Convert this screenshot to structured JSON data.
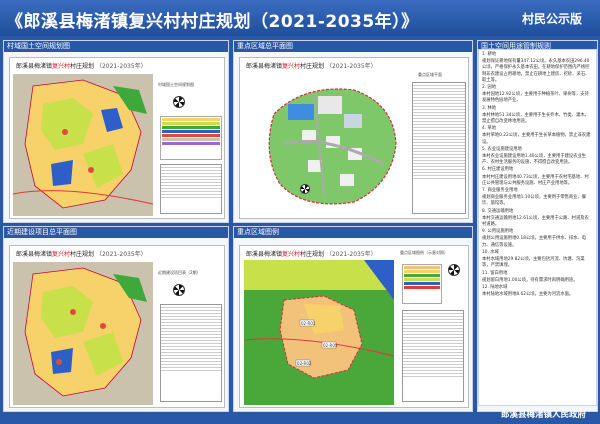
{
  "banner": {
    "title": "《郎溪县梅渚镇复兴村村庄规划（2021-2035年）》",
    "tag": "村民公示版"
  },
  "panels": {
    "village_land": "村域国土空间规划图",
    "recent_projects": "近期建设项目总平面图",
    "key_plan": "重点区域总平面图",
    "key_map": "重点区域图例",
    "land_control": "国土空间用途管制规则"
  },
  "sheets": {
    "sheet_title_prefix": "郎溪县梅渚镇",
    "sheet_title_highlight": "复兴村",
    "sheet_title_suffix": "村庄规划",
    "sheet_year": "（2021-2035年）",
    "tag_land": "村域国土空间规划图",
    "tag_projects": "近期建设项目表（2期）",
    "tag_key": "重点区域平面",
    "tag_key_map": "重点区域图例（示意对照）"
  },
  "plot_labels": [
    "02-R01",
    "02-R05",
    "02-R02"
  ],
  "rules_text": [
    "1. 耕地",
    "规划保证耕地保有量347.12公顷。永久基本农田296.40公顷，严格保护永久基本农田。在耕地保护范围内严格控制非农建设占用耕地，禁止在耕地上建房、挖砂、采石、取土等。",
    "2. 园地",
    "本村园地12.92公顷，主要用于种植茶叶、果树等，支持发展特色园地产业。",
    "3. 林地",
    "本村林地51.34公顷，主要用于生长乔木、竹类、灌木。禁止擅自改变林地用途。",
    "4. 草地",
    "本村草地0.22公顷，主要用于生长草本植物，禁止非农建设。",
    "5. 农业设施建设用地",
    "本村农业设施建设用地1.40公顷，主要用于建设农业生产、农村生活服务的设施，不得擅自改变用途。",
    "6. 村庄建设用地",
    "本村村庄建设用地40.73公顷，主要用于农村宅基地、村庄公共管理与公共服务设施、村庄产业用地等。",
    "7. 商业服务业用地",
    "规划商业服务业用地1.10公顷，主要用于零售商业、餐饮、旅馆等。",
    "8. 交通运输用地",
    "本村交通运输用地12.61公顷，主要用于公路、村道及农村道路。",
    "9. 公用设施用地",
    "规划公用设施用地0.18公顷，主要用于供水、排水、电力、通信等设施。",
    "10. 水域",
    "本村水域用地29.82公顷，主要包括河流、坑塘、沟渠等，严禁填埋。",
    "11. 留白用地",
    "规划留白用地1.00公顷，待有需求时再明确用途。",
    "12. 陆地水域",
    "本村陆地水域用地8.62公顷，主要为河流水面。"
  ],
  "footer": "郎溪县梅渚镇人民政府",
  "colors": {
    "banner_blue": "#2a58a8",
    "residential": "#f7d16a",
    "farmland": "#c8e04a",
    "green": "#3fa83a",
    "road_red": "#e03a3a"
  }
}
